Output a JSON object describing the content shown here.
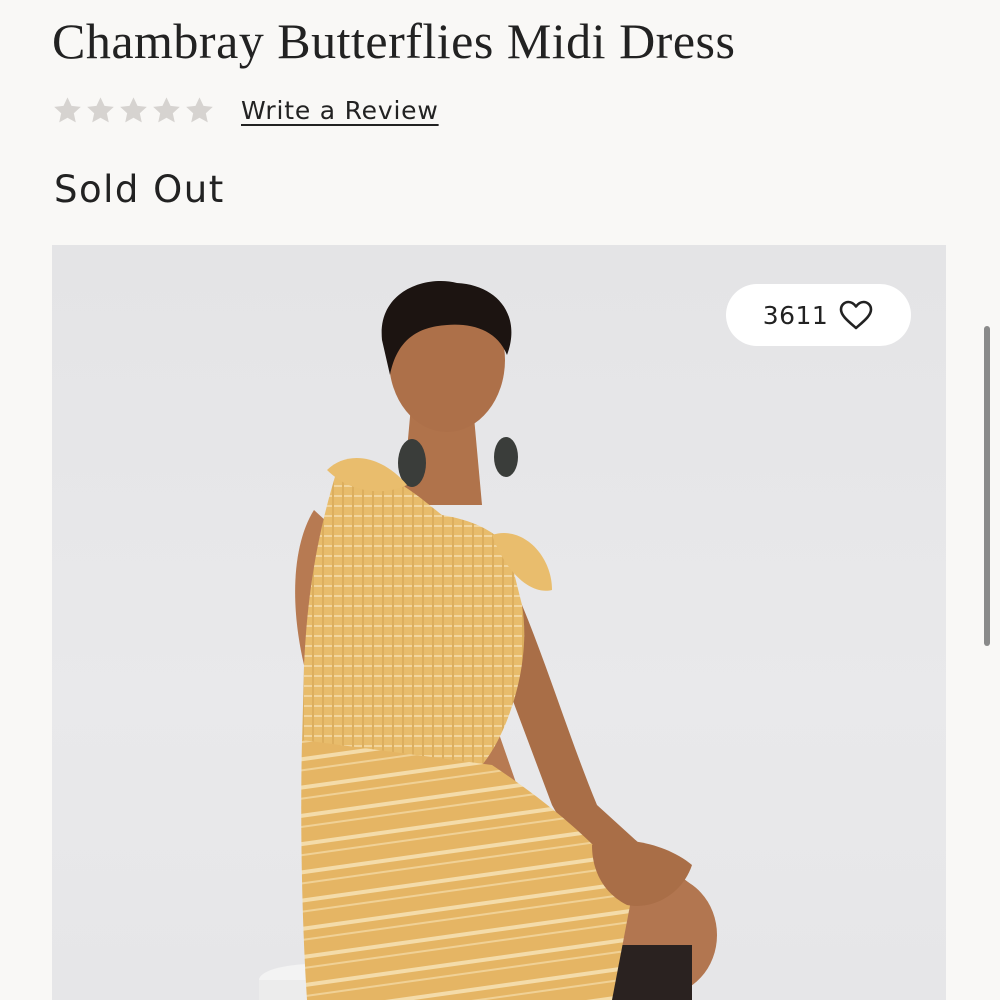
{
  "product": {
    "title": "Chambray Butterflies Midi Dress",
    "rating": {
      "stars_filled": 0,
      "stars_total": 5,
      "write_review_label": "Write a Review"
    },
    "availability": "Sold Out",
    "favorites": {
      "count": "3611",
      "icon": "heart-outline-icon"
    },
    "image": {
      "subject": "model-in-mustard-striped-dress"
    }
  },
  "colors": {
    "background": "#f9f8f6",
    "text": "#222222",
    "star_empty": "#d6d3d0",
    "dress": "#e7b863"
  }
}
